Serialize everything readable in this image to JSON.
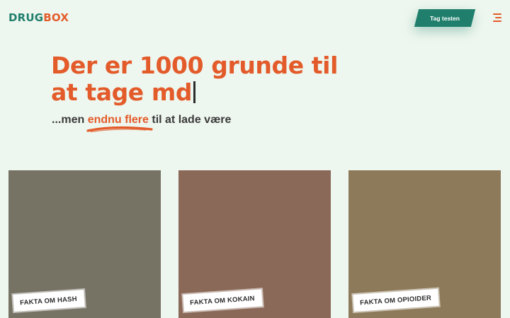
{
  "header": {
    "logo_part1": "DRUG",
    "logo_part2": "BOX",
    "cta_label": "Tag testen",
    "menu_icon": "hamburger-menu-icon"
  },
  "hero": {
    "title": "Der er 1000 grunde til at tage md",
    "subtitle_prefix": "...men ",
    "subtitle_highlight": "endnu flere",
    "subtitle_suffix": " til at lade være"
  },
  "cards": [
    {
      "label": "FAKTA OM HASH",
      "color": "#767264"
    },
    {
      "label": "FAKTA OM KOKAIN",
      "color": "#8a6958"
    },
    {
      "label": "FAKTA OM OPIOIDER",
      "color": "#8d7a5a"
    }
  ],
  "colors": {
    "background": "#eef7ef",
    "brand_green": "#1f7f6c",
    "brand_orange": "#e35b2a",
    "text_dark": "#3a3a3a"
  }
}
